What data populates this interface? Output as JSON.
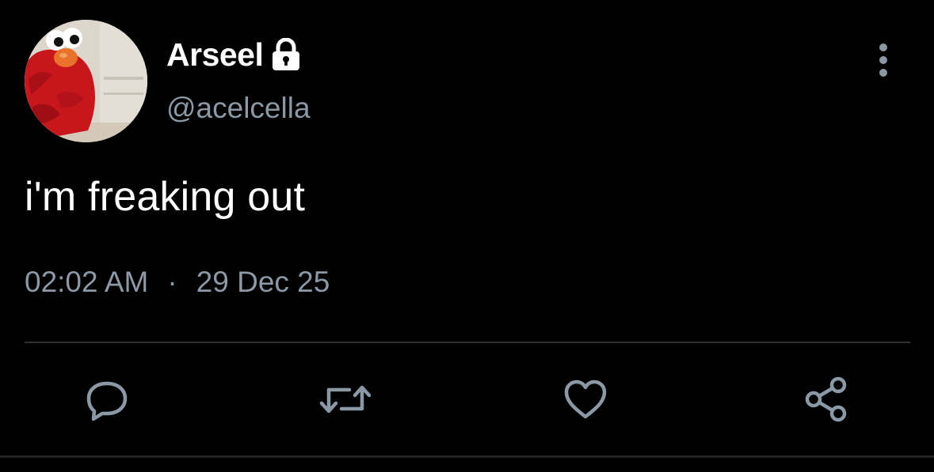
{
  "tweet": {
    "author": {
      "display_name": "Arseel",
      "handle": "@acelcella",
      "protected_icon": "lock-icon",
      "avatar_icon": "elmo-avatar"
    },
    "text": "i'm freaking out",
    "time": "02:02 AM",
    "separator": "·",
    "date": "29 Dec 25",
    "menu_icon": "more-vertical-icon"
  },
  "actions": [
    {
      "name": "reply",
      "icon": "reply-icon"
    },
    {
      "name": "retweet",
      "icon": "retweet-icon"
    },
    {
      "name": "like",
      "icon": "heart-icon"
    },
    {
      "name": "share",
      "icon": "share-icon"
    }
  ],
  "colors": {
    "background": "#000000",
    "primary_text": "#ffffff",
    "secondary_text": "#8b98a5",
    "divider": "#2f3336"
  }
}
